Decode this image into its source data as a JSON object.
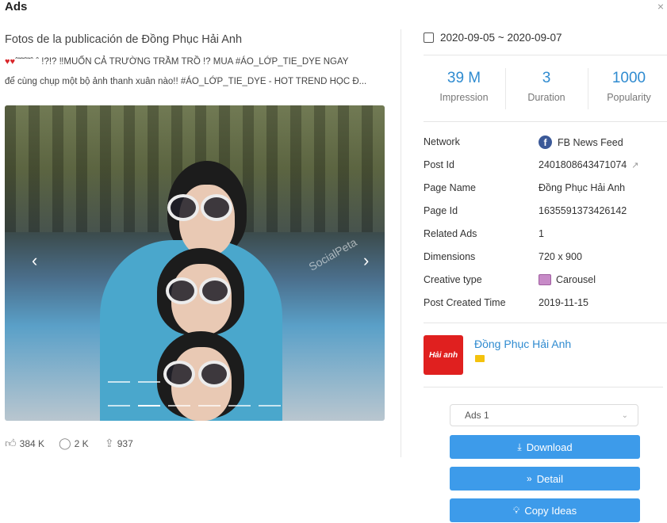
{
  "window": {
    "title": "Ads",
    "close_glyph": "×"
  },
  "post": {
    "title": "Fotos de la publicación de Đồng Phục Hải Anh",
    "hearts": "♥♥",
    "line1": "ˆ˜˜ˆ˜ˆ ˆ !?!? ‼MUỐN CẢ TRƯỜNG TRẦM TRỒ !? MUA #ÁO_LỚP_TIE_DYE NGAY",
    "line2": "để cùng chụp một bộ ảnh thanh xuân nào!! #ÁO_LỚP_TIE_DYE - HOT TREND HỌC Đ...",
    "watermark": "SocialPeta",
    "prev_glyph": "‹",
    "next_glyph": "›"
  },
  "stats": {
    "likes": "384 K",
    "comments": "2 K",
    "shares": "937"
  },
  "date_range": "2020-09-05 ~ 2020-09-07",
  "metrics": [
    {
      "value": "39 M",
      "label": "Impression"
    },
    {
      "value": "3",
      "label": "Duration"
    },
    {
      "value": "1000",
      "label": "Popularity"
    }
  ],
  "details": [
    {
      "label": "Network",
      "value": "FB News Feed"
    },
    {
      "label": "Post Id",
      "value": "2401808643471074"
    },
    {
      "label": "Page Name",
      "value": "Đồng Phục Hải Anh"
    },
    {
      "label": "Page Id",
      "value": "1635591373426142"
    },
    {
      "label": "Related Ads",
      "value": "1"
    },
    {
      "label": "Dimensions",
      "value": "720 x 900"
    },
    {
      "label": "Creative type",
      "value": "Carousel"
    },
    {
      "label": "Post Created Time",
      "value": "2019-11-15"
    }
  ],
  "advertiser": {
    "name": "Đồng Phục Hải Anh",
    "logo_text": "Hải anh"
  },
  "select": {
    "value": "Ads 1"
  },
  "buttons": {
    "download": "Download",
    "detail": "Detail",
    "copy": "Copy Ideas"
  },
  "colors": {
    "accent": "#3d9bea",
    "link": "#2f8bd0",
    "facebook": "#3b5998",
    "logo_bg": "#e0201f"
  },
  "icons": [
    "close-icon",
    "calendar-icon",
    "facebook-icon",
    "external-link-icon",
    "carousel-icon",
    "shop-icon",
    "chevron-down-icon",
    "download-icon",
    "double-chevron-icon",
    "lightbulb-icon",
    "like-icon",
    "comment-icon",
    "share-icon"
  ]
}
